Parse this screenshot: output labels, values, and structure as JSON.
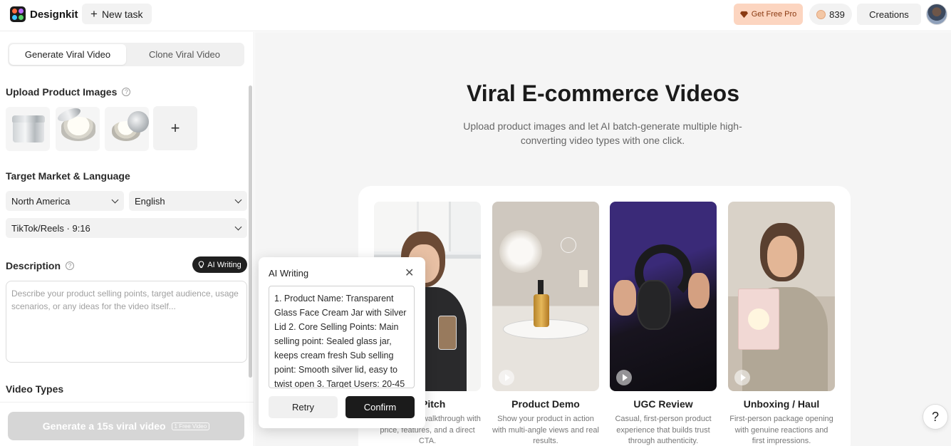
{
  "header": {
    "brand": "Designkit",
    "new_task": "New task",
    "get_pro": "Get Free Pro",
    "credits": "839",
    "creations": "Creations"
  },
  "left": {
    "tabs": [
      "Generate Viral Video",
      "Clone Viral Video"
    ],
    "active_tab": "Generate Viral Video",
    "upload_title": "Upload Product Images",
    "target_title": "Target Market & Language",
    "market": "North America",
    "language": "English",
    "platform": "TikTok/Reels · 9:16",
    "description_title": "Description",
    "ai_writing": "AI Writing",
    "description_placeholder": "Describe your product selling points, target audience, usage scenarios, or any ideas for the video itself...",
    "video_types_title": "Video Types",
    "generate_button": "Generate a 15s viral video",
    "generate_badge": "1 Free Video"
  },
  "main": {
    "title": "Viral E-commerce Videos",
    "subtitle": "Upload product images and let AI batch-generate multiple high-converting video types with one click.",
    "cards": [
      {
        "title": "ct Pitch",
        "desc": "mera product walkthrough with price, features, and a direct CTA."
      },
      {
        "title": "Product Demo",
        "desc": "Show your product in action with multi-angle views and real results."
      },
      {
        "title": "UGC Review",
        "desc": "Casual, first-person product experience that builds trust through authenticity."
      },
      {
        "title": "Unboxing / Haul",
        "desc": "First-person package opening with genuine reactions and first impressions."
      }
    ]
  },
  "popup": {
    "title": "AI Writing",
    "text": "1. Product Name: Transparent Glass Face Cream Jar with Silver Lid 2. Core Selling Points: Main selling point: Sealed glass jar, keeps cream fresh Sub selling point: Smooth silver lid, easy to twist open 3. Target Users: 20-45",
    "retry": "Retry",
    "confirm": "Confirm"
  },
  "help_fab": "?",
  "colors": {
    "accent_dark": "#1b1b1b",
    "pro_bg": "#fcd5c0",
    "main_bg": "#f5f5f5"
  },
  "icons": [
    "plus-icon",
    "diamond-icon",
    "coin-icon",
    "chevron-down-icon",
    "help-circle-icon",
    "bulb-icon",
    "close-icon",
    "play-icon"
  ]
}
